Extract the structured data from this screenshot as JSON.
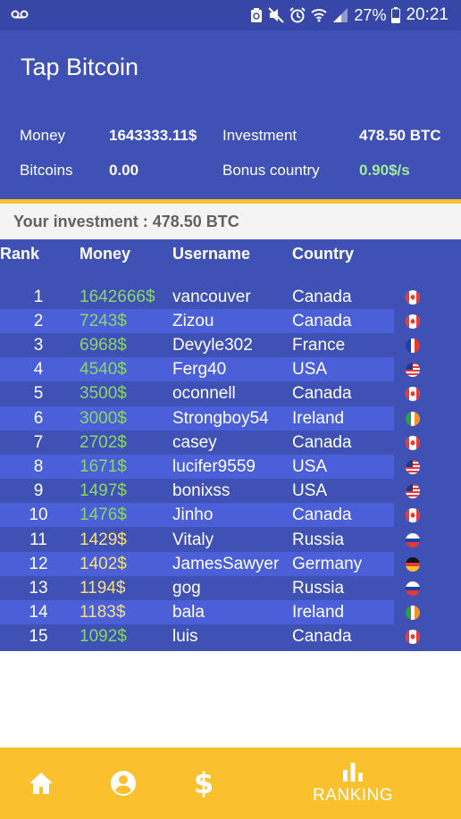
{
  "status_bar": {
    "battery": "27%",
    "time": "20:21",
    "icons": [
      "voicemail-icon",
      "sync-icon",
      "mute-icon",
      "alarm-icon",
      "wifi-icon",
      "signal-icon",
      "battery-icon"
    ]
  },
  "app": {
    "title": "Tap Bitcoin"
  },
  "stats": {
    "money_label": "Money",
    "money_value": "1643333.11$",
    "investment_label": "Investment",
    "investment_value": "478.50 BTC",
    "bitcoins_label": "Bitcoins",
    "bitcoins_value": "0.00",
    "bonus_label": "Bonus country",
    "bonus_value": "0.90$/s"
  },
  "investment_bar": {
    "text": "Your investment : 478.50 BTC"
  },
  "table": {
    "headers": {
      "rank": "Rank",
      "money": "Money",
      "username": "Username",
      "country": "Country"
    },
    "rows": [
      {
        "rank": "1",
        "money": "1642666$",
        "username": "vancouver",
        "country": "Canada",
        "flag": "canada"
      },
      {
        "rank": "2",
        "money": "7243$",
        "username": "Zizou",
        "country": "Canada",
        "flag": "canada"
      },
      {
        "rank": "3",
        "money": "6968$",
        "username": "Devyle302",
        "country": "France",
        "flag": "france"
      },
      {
        "rank": "4",
        "money": "4540$",
        "username": "Ferg40",
        "country": "USA",
        "flag": "usa"
      },
      {
        "rank": "5",
        "money": "3500$",
        "username": "oconnell",
        "country": "Canada",
        "flag": "canada"
      },
      {
        "rank": "6",
        "money": "3000$",
        "username": "Strongboy54",
        "country": "Ireland",
        "flag": "ireland"
      },
      {
        "rank": "7",
        "money": "2702$",
        "username": "casey",
        "country": "Canada",
        "flag": "canada"
      },
      {
        "rank": "8",
        "money": "1671$",
        "username": "lucifer9559",
        "country": "USA",
        "flag": "usa"
      },
      {
        "rank": "9",
        "money": "1497$",
        "username": "bonixss",
        "country": "USA",
        "flag": "usa"
      },
      {
        "rank": "10",
        "money": "1476$",
        "username": "Jinho",
        "country": "Canada",
        "flag": "canada"
      },
      {
        "rank": "11",
        "money": "1429$",
        "username": "Vitaly",
        "country": "Russia",
        "flag": "russia"
      },
      {
        "rank": "12",
        "money": "1402$",
        "username": "JamesSawyer",
        "country": "Germany",
        "flag": "germany"
      },
      {
        "rank": "13",
        "money": "1194$",
        "username": "gog",
        "country": "Russia",
        "flag": "russia"
      },
      {
        "rank": "14",
        "money": "1183$",
        "username": "bala",
        "country": "Ireland",
        "flag": "ireland"
      },
      {
        "rank": "15",
        "money": "1092$",
        "username": "luis",
        "country": "Canada",
        "flag": "canada"
      }
    ]
  },
  "bottom_nav": {
    "items": [
      {
        "name": "home",
        "icon": "home-icon",
        "label": ""
      },
      {
        "name": "profile",
        "icon": "account-circle-icon",
        "label": ""
      },
      {
        "name": "money",
        "icon": "dollar-icon",
        "label": ""
      },
      {
        "name": "ranking",
        "icon": "bar-chart-icon",
        "label": "RANKING"
      }
    ]
  },
  "colors": {
    "primary": "#3f51b5",
    "status_bar": "#3747a8",
    "row_alt": "#4a5fd8",
    "accent": "#fbc02d",
    "money_green": "#8bd66a",
    "money_yellow": "#f5e07a",
    "bonus_green": "#a5e8a0"
  }
}
